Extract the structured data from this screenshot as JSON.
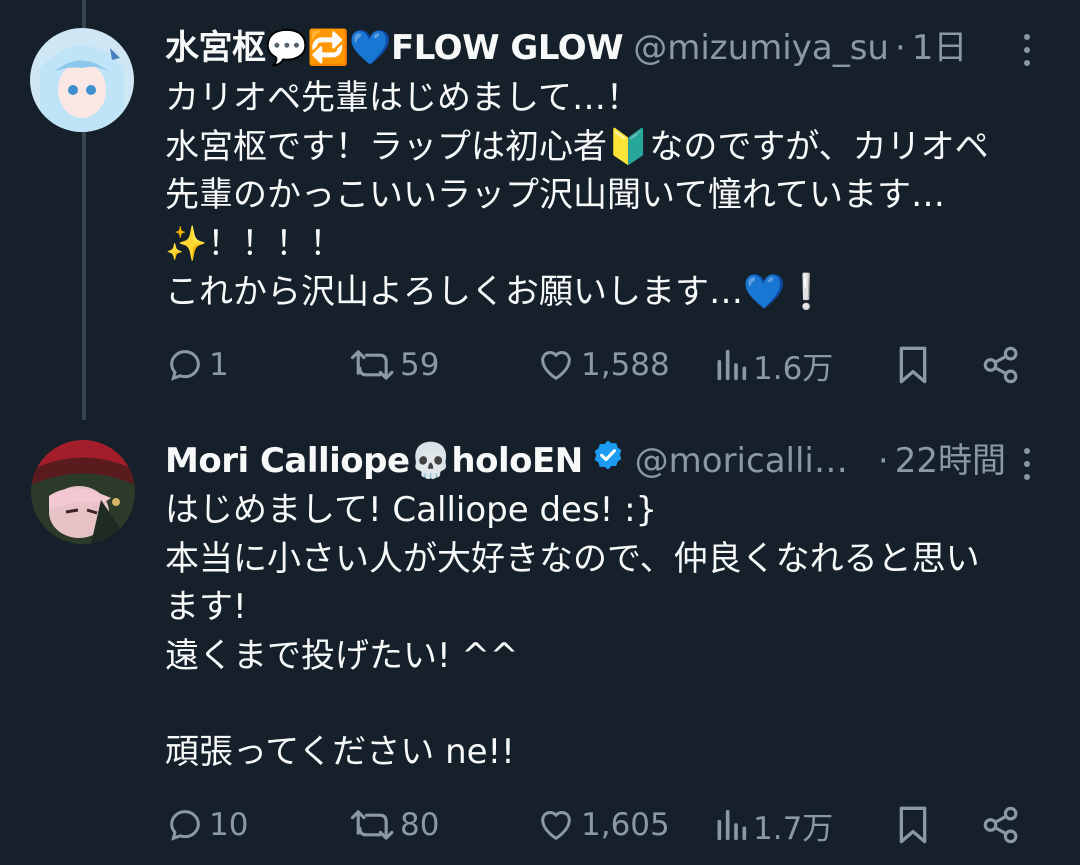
{
  "tweets": [
    {
      "name": "水宮枢💬🔁💙FLOW GLOW",
      "handle": "@mizumiya_su",
      "dot": "·",
      "time": "1日",
      "lines": [
        "カリオペ先輩はじめまして…！",
        "水宮枢です！ラップは初心者🔰なのですが、カリオペ",
        "先輩のかっこいいラップ沢山聞いて憧れています…",
        "✨！！！！",
        "これから沢山よろしくお願いします…💙❕"
      ],
      "replies": "1",
      "retweets": "59",
      "likes": "1,588",
      "views": "1.6万"
    },
    {
      "name": "Mori Calliope💀holoEN",
      "handle": "@moricalli…",
      "dot": "·",
      "time": "22時間",
      "lines": [
        "はじめまして! Calliope des! :}",
        "本当に小さい人が大好きなので、仲良くなれると思い",
        "ます!",
        "遠くまで投げたい! ^^",
        "",
        "頑張ってください  ne!!"
      ],
      "replies": "10",
      "retweets": "80",
      "likes": "1,605",
      "views": "1.7万"
    }
  ],
  "colors": {
    "background": "#15202b",
    "text": "#f7f9f9",
    "muted": "#8b98a5",
    "verified": "#1d9bf0",
    "thread_line": "#38444d"
  },
  "icons": [
    "reply-icon",
    "retweet-icon",
    "like-icon",
    "views-icon",
    "bookmark-icon",
    "share-icon",
    "more-icon",
    "verified-badge-icon"
  ]
}
